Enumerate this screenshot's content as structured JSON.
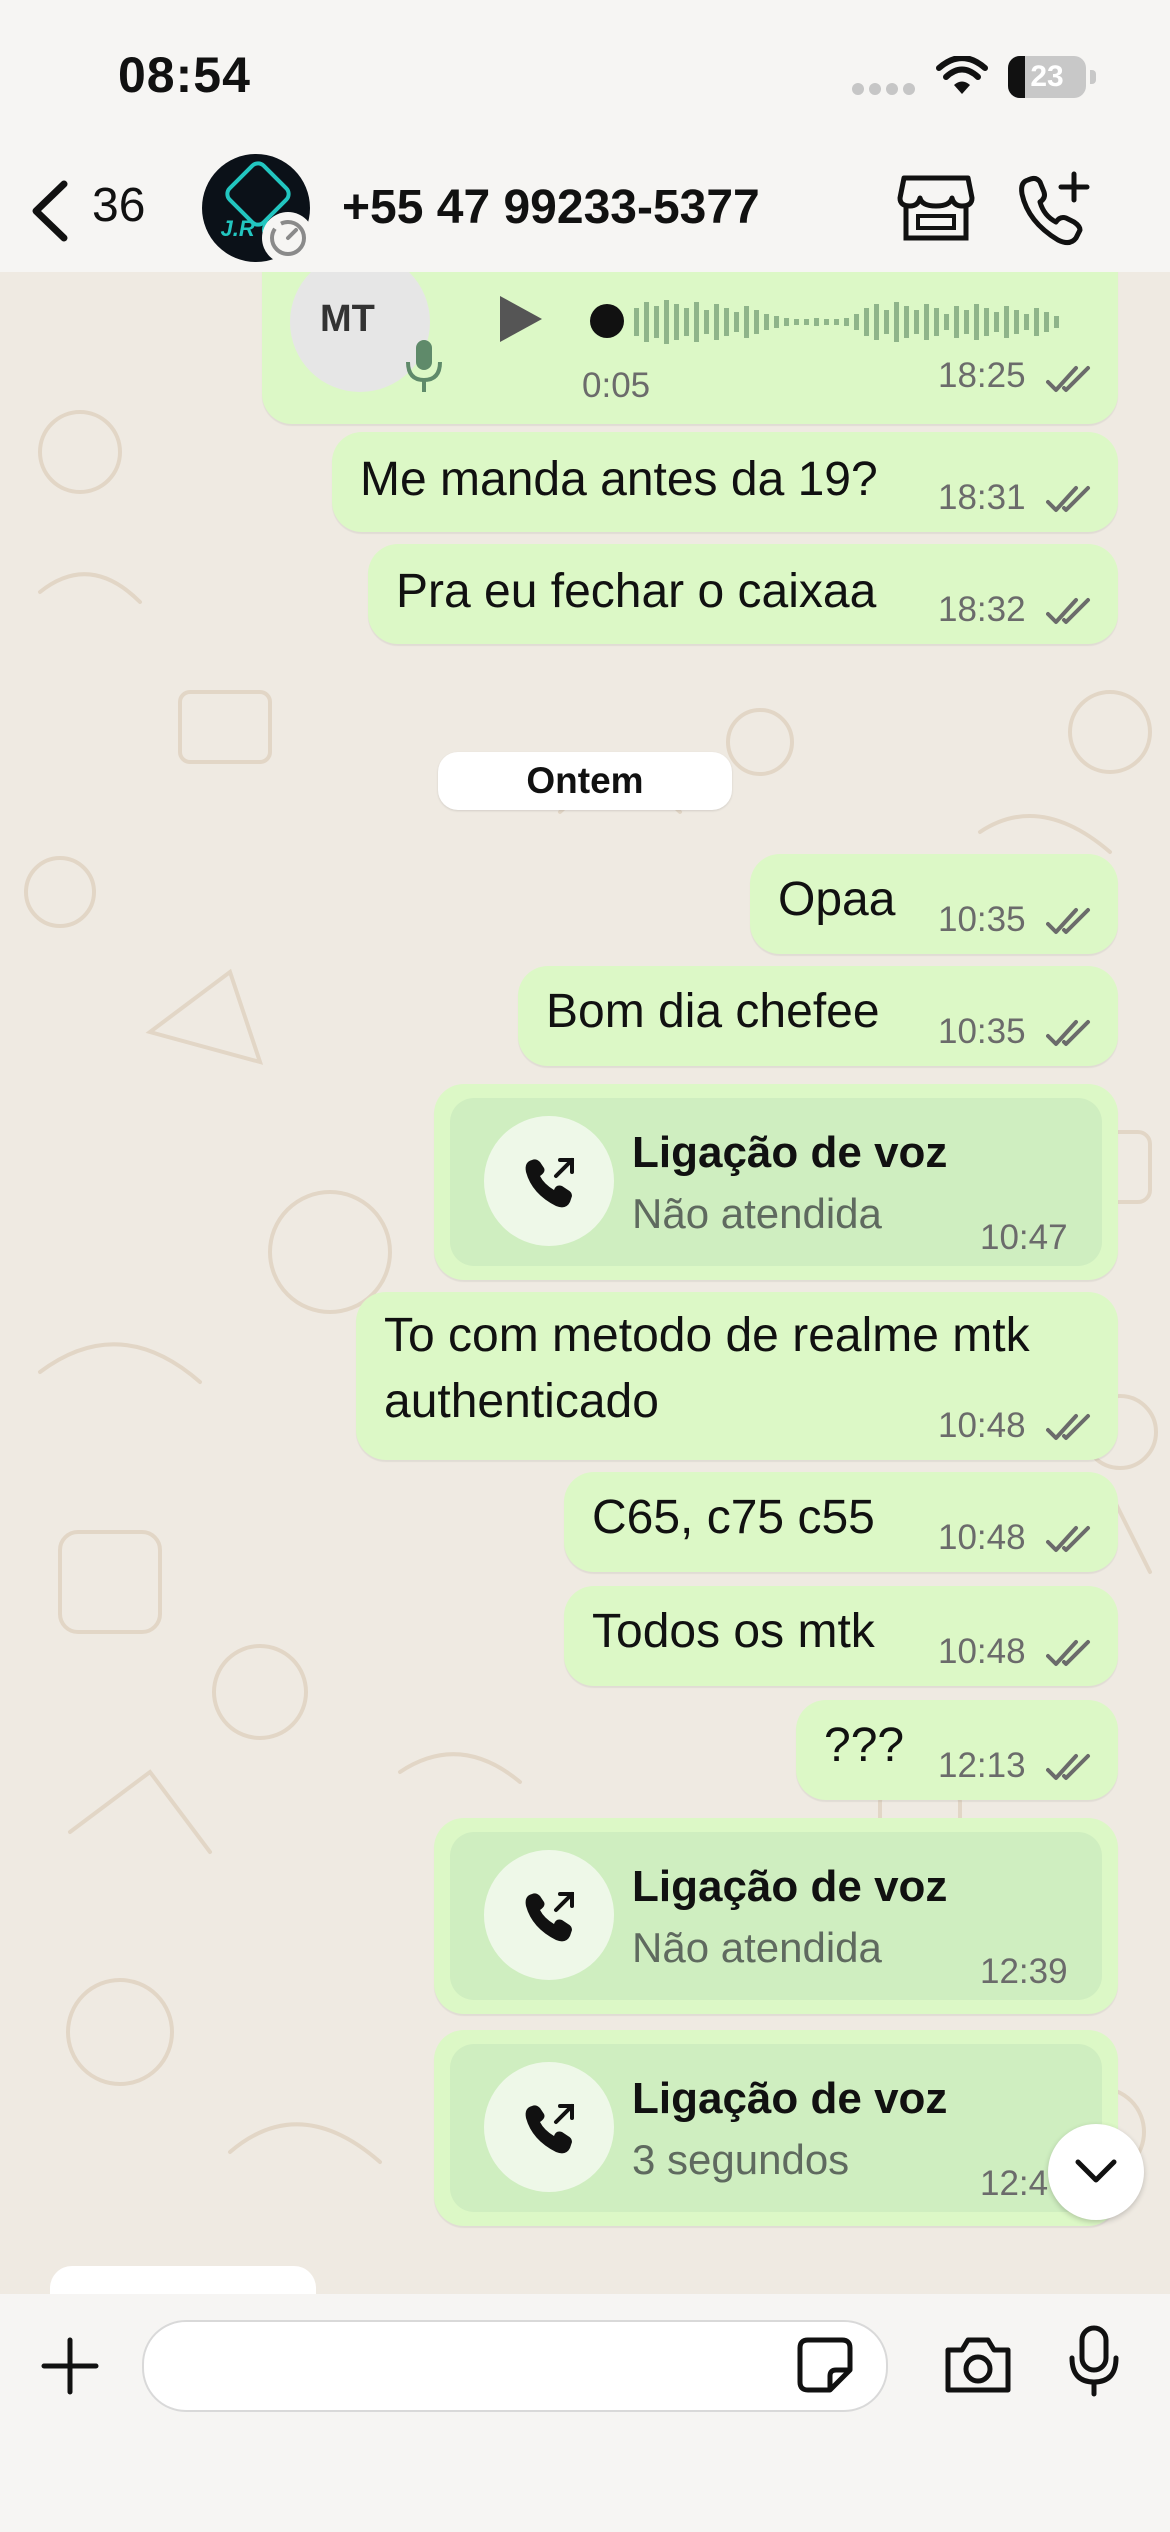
{
  "status_bar": {
    "time": "08:54",
    "battery": "23"
  },
  "header": {
    "unread_count": "36",
    "contact_name": "+55 47 99233-5377",
    "avatar_text": "J.R CE"
  },
  "audio_message": {
    "duration": "0:05",
    "time": "18:25",
    "thumb_text": "MT"
  },
  "messages_before": [
    {
      "text": "Me manda antes da 19?",
      "time": "18:31"
    },
    {
      "text": "Pra eu fechar o caixaa",
      "time": "18:32"
    }
  ],
  "date_divider": "Ontem",
  "messages": [
    {
      "text": "Opaa",
      "time": "10:35"
    },
    {
      "text": "Bom dia chefee",
      "time": "10:35"
    },
    {
      "call_title": "Ligação de voz",
      "call_sub": "Não atendida",
      "time": "10:47"
    },
    {
      "text_line1": "To com metodo de realme mtk",
      "text_line2": "authenticado",
      "time": "10:48"
    },
    {
      "text": "C65, c75 c55",
      "time": "10:48"
    },
    {
      "text": "Todos os mtk",
      "time": "10:48"
    },
    {
      "text": "???",
      "time": "12:13"
    },
    {
      "call_title": "Ligação de voz",
      "call_sub": "Não atendida",
      "time": "12:39"
    },
    {
      "call_title": "Ligação de voz",
      "call_sub": "3 segundos",
      "time": "12:4"
    }
  ],
  "colors": {
    "outgoing_bubble": "#dcf8c6",
    "call_card": "#cfeec0",
    "chat_background": "#efeae2",
    "ticks": "#6b6b6b"
  },
  "icons": [
    "back-chevron-icon",
    "store-icon",
    "add-call-icon",
    "play-icon",
    "mic-icon",
    "phone-outgoing-icon",
    "chevron-down-icon",
    "plus-icon",
    "sticker-icon",
    "camera-icon",
    "microphone-icon"
  ]
}
